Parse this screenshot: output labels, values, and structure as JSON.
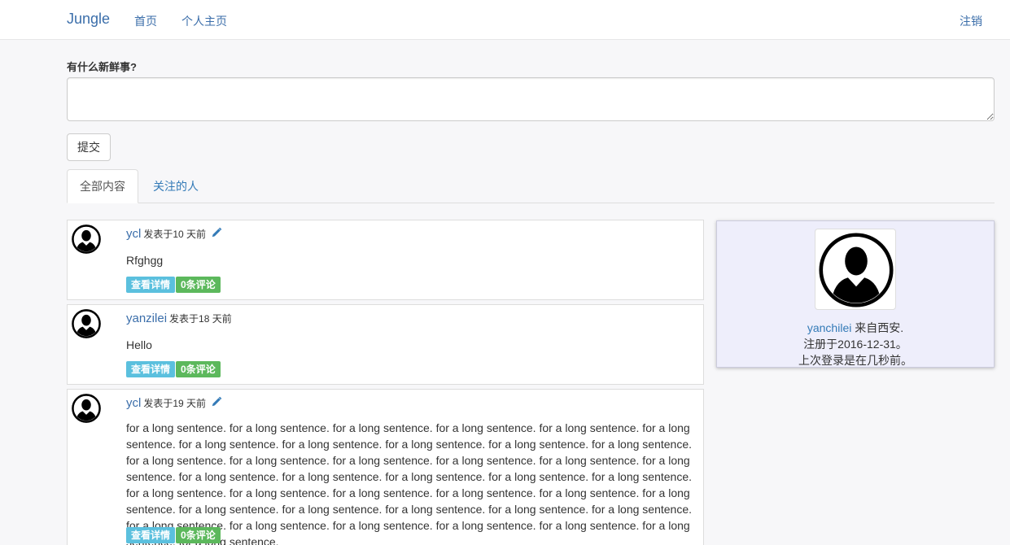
{
  "navbar": {
    "brand": "Jungle",
    "home": "首页",
    "profile": "个人主页",
    "logout": "注销"
  },
  "post_form": {
    "prompt": "有什么新鲜事?",
    "textarea_value": "",
    "submit_label": "提交"
  },
  "tabs": {
    "all": "全部内容",
    "following": "关注的人"
  },
  "posts": [
    {
      "author": "ycl",
      "meta": "发表于10 天前",
      "editable": true,
      "body": "Rfghgg",
      "detail_label": "查看详情",
      "comments_label": "0条评论"
    },
    {
      "author": "yanzilei",
      "meta": "发表于18 天前",
      "editable": false,
      "body": "Hello",
      "detail_label": "查看详情",
      "comments_label": "0条评论"
    },
    {
      "author": "ycl",
      "meta": "发表于19 天前",
      "editable": true,
      "body": "for a long sentence. for a long sentence. for a long sentence. for a long sentence. for a long sentence. for a long sentence. for a long sentence. for a long sentence. for a long sentence. for a long sentence. for a long sentence. for a long sentence. for a long sentence. for a long sentence. for a long sentence. for a long sentence. for a long sentence. for a long sentence. for a long sentence. for a long sentence. for a long sentence. for a long sentence. for a long sentence. for a long sentence. for a long sentence. for a long sentence. for a long sentence. for a long sentence. for a long sentence. for a long sentence. for a long sentence. for a long sentence. for a long sentence. for a long sentence. for a long sentence. for a long sentence. for a long sentence. for a long sentence. for a long sentence. for a long sentence.",
      "detail_label": "查看详情",
      "comments_label": "0条评论"
    }
  ],
  "profile_card": {
    "username": "yanchilei",
    "location": " 来自西安.",
    "registered": "注册于2016-12-31。",
    "last_login": "上次登录是在几秒前。"
  },
  "icons": {
    "avatar": "default-user-silhouette-icon",
    "edit": "pencil-icon"
  },
  "colors": {
    "link": "#337ab7",
    "badge_detail": "#5bc0de",
    "badge_comments": "#5cb85c",
    "profile_card_bg": "#eeeefb"
  }
}
